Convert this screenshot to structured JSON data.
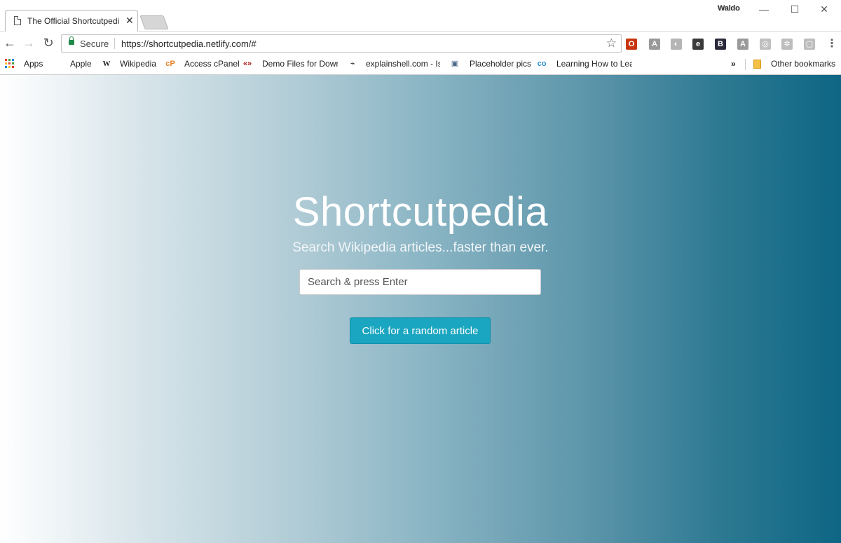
{
  "browser": {
    "tab": {
      "title": "The Official Shortcutpedi",
      "close": "✕"
    },
    "profile": "Waldo",
    "window_controls": [
      "—",
      "☐",
      "✕"
    ],
    "nav": {
      "back": "←",
      "forward": "→",
      "reload": "↻"
    },
    "omnibox": {
      "secure_label": "Secure",
      "url": "https://shortcutpedia.netlify.com/#",
      "star": "☆"
    },
    "extensions": [
      {
        "icon": "opera-icon",
        "glyph": "O",
        "color": "#c8360f"
      },
      {
        "icon": "translate-icon",
        "glyph": "A",
        "color": "#9a9a9a"
      },
      {
        "icon": "sync-icon",
        "glyph": "◐",
        "color": "#b5b5b5"
      },
      {
        "icon": "evernote-icon",
        "glyph": "e",
        "color": "#3a3a3a"
      },
      {
        "icon": "bold-b-icon",
        "glyph": "B",
        "color": "#2a2a3a"
      },
      {
        "icon": "pdf-icon",
        "glyph": "A",
        "color": "#9a9a9a"
      },
      {
        "icon": "circle-icon",
        "glyph": "◎",
        "color": "#c0c0c0"
      },
      {
        "icon": "gear-icon",
        "glyph": "✲",
        "color": "#bdbdbd"
      },
      {
        "icon": "window-icon",
        "glyph": "▢",
        "color": "#bdbdbd"
      },
      {
        "icon": "menu-icon",
        "glyph": "⋮",
        "color": "#666666"
      }
    ]
  },
  "bookmarks": {
    "items": [
      {
        "label": "Apps",
        "icon": "apps-grid-icon"
      },
      {
        "label": "Apple",
        "icon": "apple-icon",
        "glyph": "",
        "icon_color": "#555555"
      },
      {
        "label": "Wikipedia",
        "icon": "wikipedia-icon",
        "glyph": "W",
        "icon_color": "#222222"
      },
      {
        "label": "Access cPanel",
        "icon": "cpanel-icon",
        "glyph": "cP",
        "icon_color": "#e8822a"
      },
      {
        "label": "Demo Files for Dowr",
        "icon": "demo-files-icon",
        "glyph": "«»",
        "icon_color": "#b01e1e"
      },
      {
        "label": "explainshell.com - Is",
        "icon": "explainshell-icon",
        "glyph": "⌁",
        "icon_color": "#222222"
      },
      {
        "label": "Placeholder pics",
        "icon": "placeholder-icon",
        "glyph": "▣",
        "icon_color": "#4a6a8a"
      },
      {
        "label": "Learning How to Lea",
        "icon": "coursera-icon",
        "glyph": "co",
        "icon_color": "#2f8fd0"
      }
    ],
    "overflow": "»",
    "other": "Other bookmarks"
  },
  "hero": {
    "title": "Shortcutpedia",
    "subtitle": "Search Wikipedia articles...faster than ever.",
    "search_placeholder": "Search & press Enter",
    "random_button": "Click for a random article"
  }
}
